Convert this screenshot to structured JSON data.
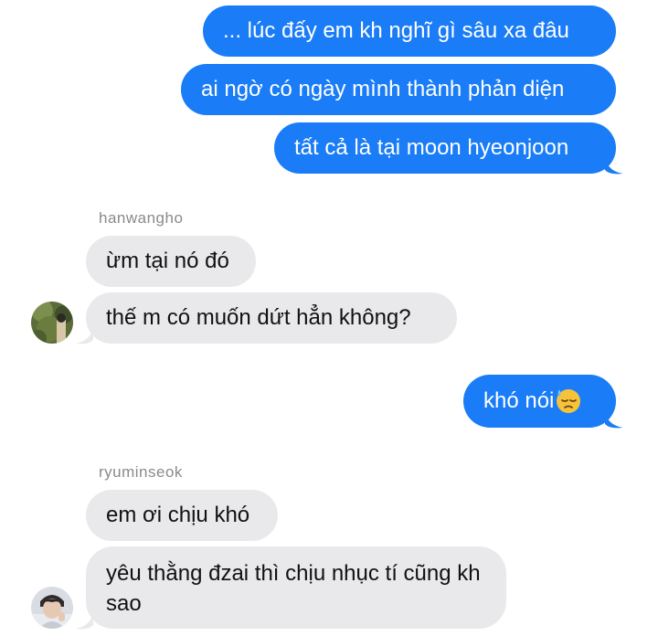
{
  "messages": {
    "out1": "... lúc đấy em kh nghĩ gì sâu xa đâu",
    "out2": "ai ngờ có ngày mình thành phản diện",
    "out3": "tất cả là tại moon hyeonjoon",
    "sender1": "hanwangho",
    "in1": "ừm tại nó đó",
    "in2": "thế m có muốn dứt hẳn không?",
    "out4": "khó nói",
    "sender2": "ryuminseok",
    "in3": "em ơi chịu khó",
    "in4": "yêu thằng đzai thì chịu nhục tí cũng kh sao"
  },
  "icons": {
    "out4_emoji": "downcast-face-with-sweat-emoji",
    "avatar1": "contact-photo-hanwangho",
    "avatar2": "contact-photo-ryuminseok"
  },
  "colors": {
    "outgoing_bubble": "#1a7cf6",
    "incoming_bubble": "#e9e9eb",
    "sender_name": "#8a8a8e"
  }
}
